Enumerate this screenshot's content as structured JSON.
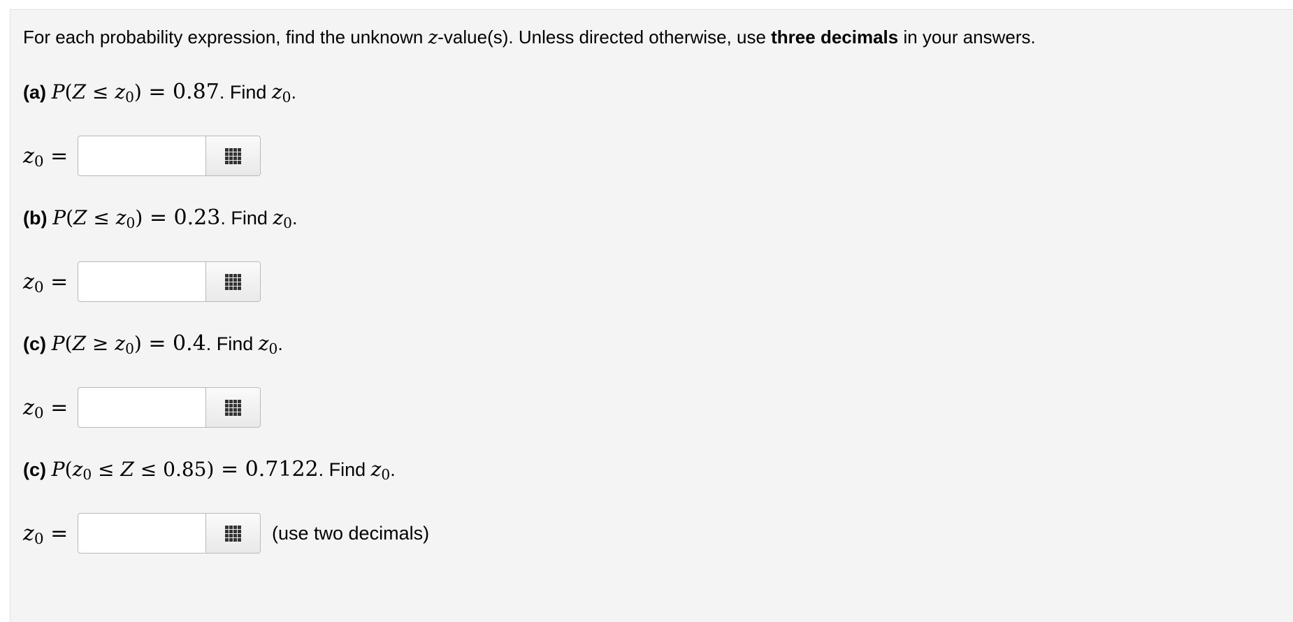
{
  "intro": {
    "text_before": "For each probability expression, find the unknown ",
    "z_symbol": "z",
    "text_mid": "-value(s). Unless directed otherwise, use ",
    "bold": "three decimals",
    "text_after": " in your answers."
  },
  "questions": [
    {
      "label": "(a)",
      "math_P": "P",
      "math_open": "(",
      "math_Z": "Z",
      "math_rel": " ≤ ",
      "math_z": "z",
      "math_sub": "0",
      "math_close": ")",
      "math_eq": " = 0.87",
      "find_text": ". Find ",
      "find_z": "z",
      "find_sub": "0",
      "find_end": ".",
      "answer_z": "z",
      "answer_sub": "0",
      "answer_eq": " =",
      "input_value": "",
      "input_placeholder": "",
      "note": ""
    },
    {
      "label": "(b)",
      "math_P": "P",
      "math_open": "(",
      "math_Z": "Z",
      "math_rel": " ≤ ",
      "math_z": "z",
      "math_sub": "0",
      "math_close": ")",
      "math_eq": " = 0.23",
      "find_text": ". Find ",
      "find_z": "z",
      "find_sub": "0",
      "find_end": ".",
      "answer_z": "z",
      "answer_sub": "0",
      "answer_eq": " =",
      "input_value": "",
      "input_placeholder": "",
      "note": ""
    },
    {
      "label": "(c)",
      "math_P": "P",
      "math_open": "(",
      "math_Z": "Z",
      "math_rel": " ≥ ",
      "math_z": "z",
      "math_sub": "0",
      "math_close": ")",
      "math_eq": " = 0.4",
      "find_text": ". Find ",
      "find_z": "z",
      "find_sub": "0",
      "find_end": ".",
      "answer_z": "z",
      "answer_sub": "0",
      "answer_eq": " =",
      "input_value": "",
      "input_placeholder": "",
      "note": ""
    },
    {
      "label": "(c)",
      "math_P": "P",
      "math_open": "(",
      "math_z": "z",
      "math_sub": "0",
      "math_rel1": " ≤ ",
      "math_Z": "Z",
      "math_rel2": " ≤ 0.85",
      "math_close": ")",
      "math_eq": " = 0.7122",
      "find_text": ". Find ",
      "find_z": "z",
      "find_sub": "0",
      "find_end": ".",
      "answer_z": "z",
      "answer_sub": "0",
      "answer_eq": " =",
      "input_value": "",
      "input_placeholder": "",
      "note": "(use two decimals)"
    }
  ],
  "icons": {
    "keypad_button": "keypad-grid-icon"
  }
}
